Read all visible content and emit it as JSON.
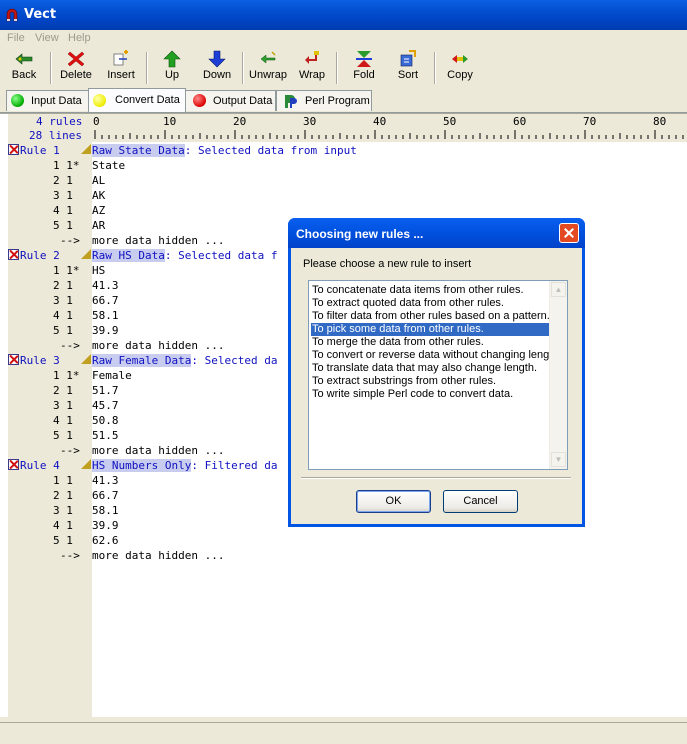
{
  "window": {
    "title": "Vect"
  },
  "menu": [
    "File",
    "View",
    "Help"
  ],
  "toolbar": {
    "back": "Back",
    "delete": "Delete",
    "insert": "Insert",
    "up": "Up",
    "down": "Down",
    "unwrap": "Unwrap",
    "wrap": "Wrap",
    "fold": "Fold",
    "sort": "Sort",
    "copy": "Copy"
  },
  "tabs": {
    "input": "Input Data",
    "convert": "Convert Data",
    "output": "Output Data",
    "perl": "Perl Program"
  },
  "editor": {
    "rules_count": "4 rules",
    "lines_count": "28 lines",
    "ruler_labels": [
      "0",
      "10",
      "20",
      "30",
      "40",
      "50",
      "60",
      "70",
      "80"
    ],
    "rules": [
      {
        "label": "Rule 1",
        "name": "Raw State Data",
        "desc": ": Selected data from input",
        "rows": [
          [
            "1 1*",
            "State"
          ],
          [
            "2 1",
            "AL"
          ],
          [
            "3 1",
            "AK"
          ],
          [
            "4 1",
            "AZ"
          ],
          [
            "5 1",
            "AR"
          ]
        ]
      },
      {
        "label": "Rule 2",
        "name": "Raw HS Data",
        "desc": ": Selected data f",
        "rows": [
          [
            "1 1*",
            "HS"
          ],
          [
            "2 1",
            "41.3"
          ],
          [
            "3 1",
            "66.7"
          ],
          [
            "4 1",
            "58.1"
          ],
          [
            "5 1",
            "39.9"
          ]
        ]
      },
      {
        "label": "Rule 3",
        "name": "Raw Female Data",
        "desc": ": Selected da",
        "rows": [
          [
            "1 1*",
            "Female"
          ],
          [
            "2 1",
            "51.7"
          ],
          [
            "3 1",
            "45.7"
          ],
          [
            "4 1",
            "50.8"
          ],
          [
            "5 1",
            "51.5"
          ]
        ]
      },
      {
        "label": "Rule 4",
        "name": "HS Numbers Only",
        "desc": ": Filtered da",
        "rows": [
          [
            "1 1",
            "41.3"
          ],
          [
            "2 1",
            "66.7"
          ],
          [
            "3 1",
            "58.1"
          ],
          [
            "4 1",
            "39.9"
          ],
          [
            "5 1",
            "62.6"
          ]
        ]
      }
    ],
    "more_arrow": "-->",
    "more_text": "more data hidden ..."
  },
  "dialog": {
    "title": "Choosing new rules ...",
    "prompt": "Please choose a new rule to insert",
    "options": [
      "To concatenate data items from other rules.",
      "To extract quoted data from other rules.",
      "To filter data from other rules based on a pattern.",
      "To pick some data from other rules.",
      "To merge the data from other rules.",
      "To convert or reverse data without changing length.",
      "To translate data that may also change length.",
      "To extract substrings from other rules.",
      "To write simple Perl code to convert data."
    ],
    "selected_index": 3,
    "ok": "OK",
    "cancel": "Cancel"
  }
}
